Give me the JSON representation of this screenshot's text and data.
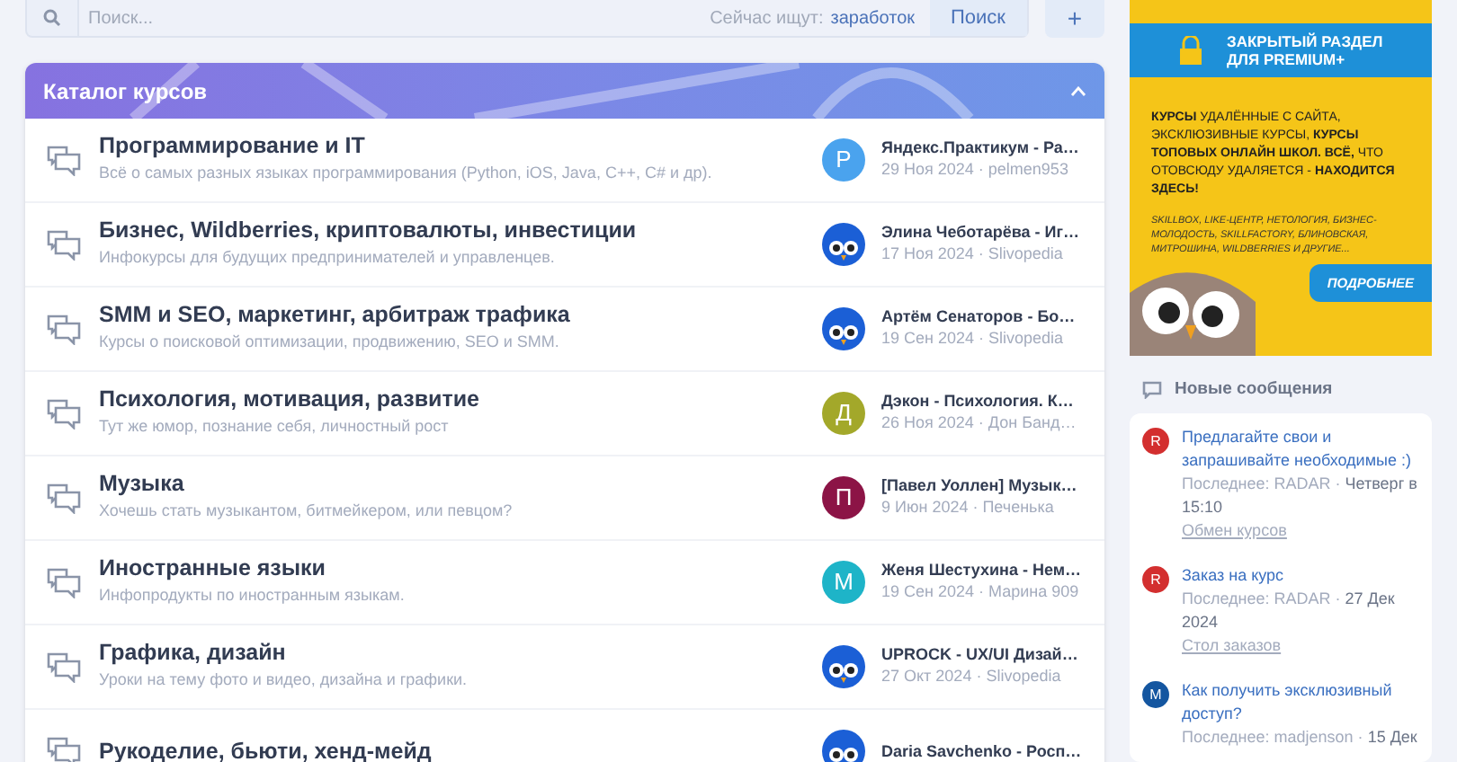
{
  "search": {
    "placeholder": "Поиск...",
    "trending_label": "Сейчас ищут:",
    "trending_term": "заработок",
    "button": "Поиск",
    "add_button": "+"
  },
  "catalog": {
    "title": "Каталог курсов",
    "expanded": true,
    "forums": [
      {
        "title": "Программирование и IT",
        "description": "Всё о самых разных языках программирования (Python, iOS, Java, C++, C# и др).",
        "last_post": {
          "avatar": {
            "kind": "letter",
            "letter": "P",
            "color": "#4aa3ee"
          },
          "title": "Яндекс.Практикум - Ра…",
          "meta": "29 Ноя 2024 · pelmen953"
        }
      },
      {
        "title": "Бизнес, Wildberries, криптовалюты, инвестиции",
        "description": "Инфокурсы для будущих предпринимателей и управленцев.",
        "last_post": {
          "avatar": {
            "kind": "owl",
            "color": "#1b5fd6"
          },
          "title": "Элина Чеботарёва - Иг…",
          "meta": "17 Ноя 2024 · Slivopedia"
        }
      },
      {
        "title": "SMM и SEO, маркетинг, арбитраж трафика",
        "description": "Курсы о поисковой оптимизации, продвижению, SEO и SMM.",
        "last_post": {
          "avatar": {
            "kind": "owl",
            "color": "#1b5fd6"
          },
          "title": "Артём Сенаторов - Бо…",
          "meta": "19 Сен 2024 · Slivopedia"
        }
      },
      {
        "title": "Психология, мотивация, развитие",
        "description": "Тут же юмор, познание себя, личностный рост",
        "last_post": {
          "avatar": {
            "kind": "letter",
            "letter": "Д",
            "color": "#a3a82a"
          },
          "title": "Дэкон - Психология. К…",
          "meta": "26 Ноя 2024 · Дон Банд…"
        }
      },
      {
        "title": "Музыка",
        "description": "Хочешь стать музыкантом, битмейкером, или певцом?",
        "last_post": {
          "avatar": {
            "kind": "letter",
            "letter": "П",
            "color": "#8c1446"
          },
          "title": "[Павел Уоллен] Музык…",
          "meta": "9 Июн 2024 · Печенька"
        }
      },
      {
        "title": "Иностранные языки",
        "description": "Инфопродукты по иностранным языкам.",
        "last_post": {
          "avatar": {
            "kind": "letter",
            "letter": "М",
            "color": "#1eb4c8"
          },
          "title": "Женя Шестухина - Нем…",
          "meta": "19 Сен 2024 · Марина 909"
        }
      },
      {
        "title": "Графика, дизайн",
        "description": "Уроки на тему фото и видео, дизайна и графики.",
        "last_post": {
          "avatar": {
            "kind": "owl",
            "color": "#1b5fd6"
          },
          "title": "UPROCK - UX/UI Дизай…",
          "meta": "27 Окт 2024 · Slivopedia"
        }
      },
      {
        "title": "Рукоделие, бьюти, хенд-мейд",
        "last_post": {
          "avatar": {
            "kind": "owl",
            "color": "#1b5fd6"
          },
          "title": "Daria Savchenko - Росп…"
        }
      }
    ]
  },
  "banner": {
    "heading_1": "ЗАКРЫТЫЙ РАЗДЕЛ",
    "heading_2": "ДЛЯ PREMIUM+",
    "text": "**КУРСЫ** УДАЛЁННЫЕ С САЙТА, ЭКСКЛЮЗИВНЫЕ КУРСЫ, **КУРСЫ ТОПОВЫХ ОНЛАЙН ШКОЛ. ВСЁ,** ЧТО ОТОВСЮДУ УДАЛЯЕТСЯ - **НАХОДИТСЯ ЗДЕСЬ!**",
    "schools": "SKILLBOX, LIKE-ЦЕНТР, НЕТОЛОГИЯ, БИЗНЕС-МОЛОДОСТЬ, SKILLFACTORY, БЛИНОВСКАЯ, МИТРОШИНА, WILDBERRIES И ДРУГИЕ...",
    "button": "ПОДРОБНЕЕ"
  },
  "new_messages": {
    "title": "Новые сообщения",
    "items": [
      {
        "avatar_letter": "R",
        "color": "#d32f2f",
        "title": "Предлагайте свои и запрашивайте необходимые :)",
        "meta": "Последнее: RADAR ·",
        "date": "Четверг в 15:10",
        "forum": "Обмен курсов"
      },
      {
        "avatar_letter": "R",
        "color": "#d32f2f",
        "title": "Заказ на курс",
        "meta": "Последнее: RADAR ·",
        "date": "27 Дек 2024",
        "forum": "Стол заказов"
      },
      {
        "avatar_letter": "M",
        "color": "#1456a0",
        "title": "Как получить эксклюзивный доступ?",
        "meta": "Последнее: madjenson ·",
        "date": "15 Дек"
      }
    ]
  }
}
